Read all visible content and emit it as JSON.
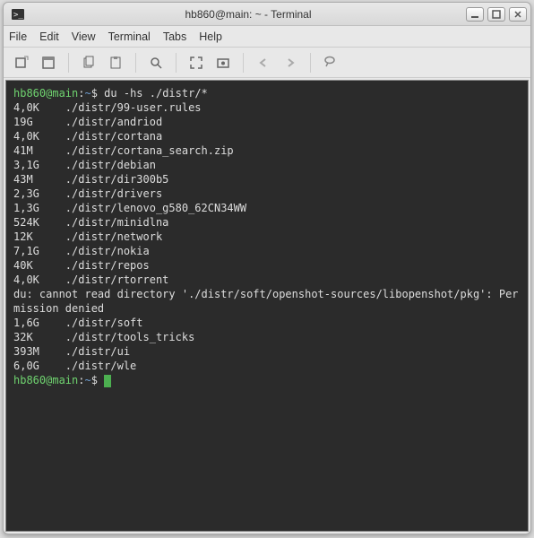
{
  "window": {
    "title": "hb860@main: ~ - Terminal"
  },
  "menubar": {
    "file": "File",
    "edit": "Edit",
    "view": "View",
    "terminal": "Terminal",
    "tabs": "Tabs",
    "help": "Help"
  },
  "prompt": {
    "user_host": "hb860@main",
    "colon": ":",
    "path": "~",
    "symbol": "$"
  },
  "command": "du -hs ./distr/*",
  "output_rows": [
    {
      "size": "4,0K",
      "path": "./distr/99-user.rules"
    },
    {
      "size": "19G",
      "path": "./distr/andriod"
    },
    {
      "size": "4,0K",
      "path": "./distr/cortana"
    },
    {
      "size": "41M",
      "path": "./distr/cortana_search.zip"
    },
    {
      "size": "3,1G",
      "path": "./distr/debian"
    },
    {
      "size": "43M",
      "path": "./distr/dir300b5"
    },
    {
      "size": "2,3G",
      "path": "./distr/drivers"
    },
    {
      "size": "1,3G",
      "path": "./distr/lenovo_g580_62CN34WW"
    },
    {
      "size": "524K",
      "path": "./distr/minidlna"
    },
    {
      "size": "12K",
      "path": "./distr/network"
    },
    {
      "size": "7,1G",
      "path": "./distr/nokia"
    },
    {
      "size": "40K",
      "path": "./distr/repos"
    },
    {
      "size": "4,0K",
      "path": "./distr/rtorrent"
    }
  ],
  "error_line": "du: cannot read directory './distr/soft/openshot-sources/libopenshot/pkg': Permission denied",
  "output_rows2": [
    {
      "size": "1,6G",
      "path": "./distr/soft"
    },
    {
      "size": "32K",
      "path": "./distr/tools_tricks"
    },
    {
      "size": "393M",
      "path": "./distr/ui"
    },
    {
      "size": "6,0G",
      "path": "./distr/wle"
    }
  ]
}
